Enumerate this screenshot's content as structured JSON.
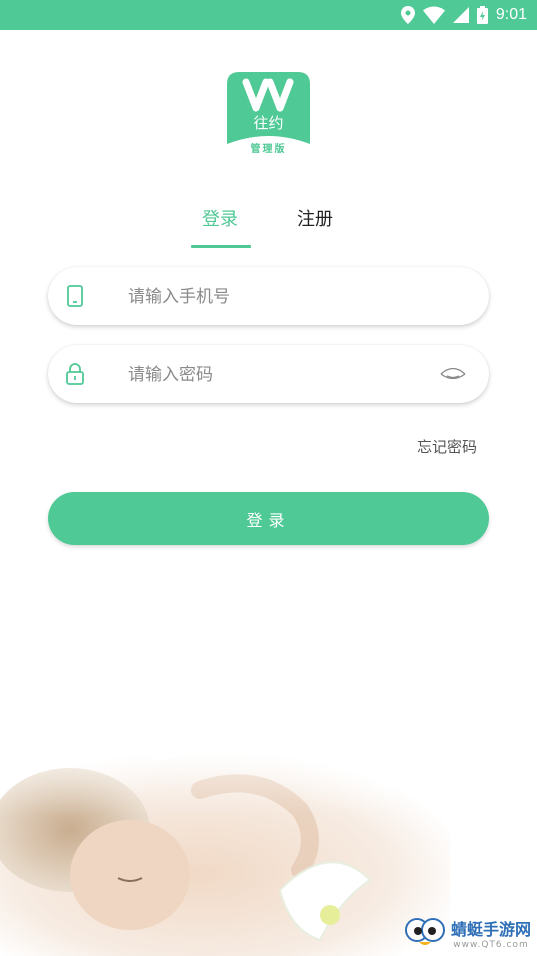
{
  "status_bar": {
    "time": "9:01",
    "icons": [
      "location-icon",
      "wifi-icon",
      "signal-icon",
      "battery-icon"
    ]
  },
  "logo": {
    "app_name": "往约",
    "edition": "管理版"
  },
  "tabs": {
    "login": "登录",
    "register": "注册"
  },
  "phone_field": {
    "placeholder": "请输入手机号",
    "value": ""
  },
  "password_field": {
    "placeholder": "请输入密码",
    "value": ""
  },
  "forgot_password": "忘记密码",
  "login_button": "登录",
  "watermark": {
    "title": "蜻蜓手游网",
    "url": "www.QT6.com"
  },
  "colors": {
    "accent": "#4fc995",
    "status_bar": "#4fc995",
    "text_dark": "#222222",
    "placeholder": "#8a8a8a"
  }
}
